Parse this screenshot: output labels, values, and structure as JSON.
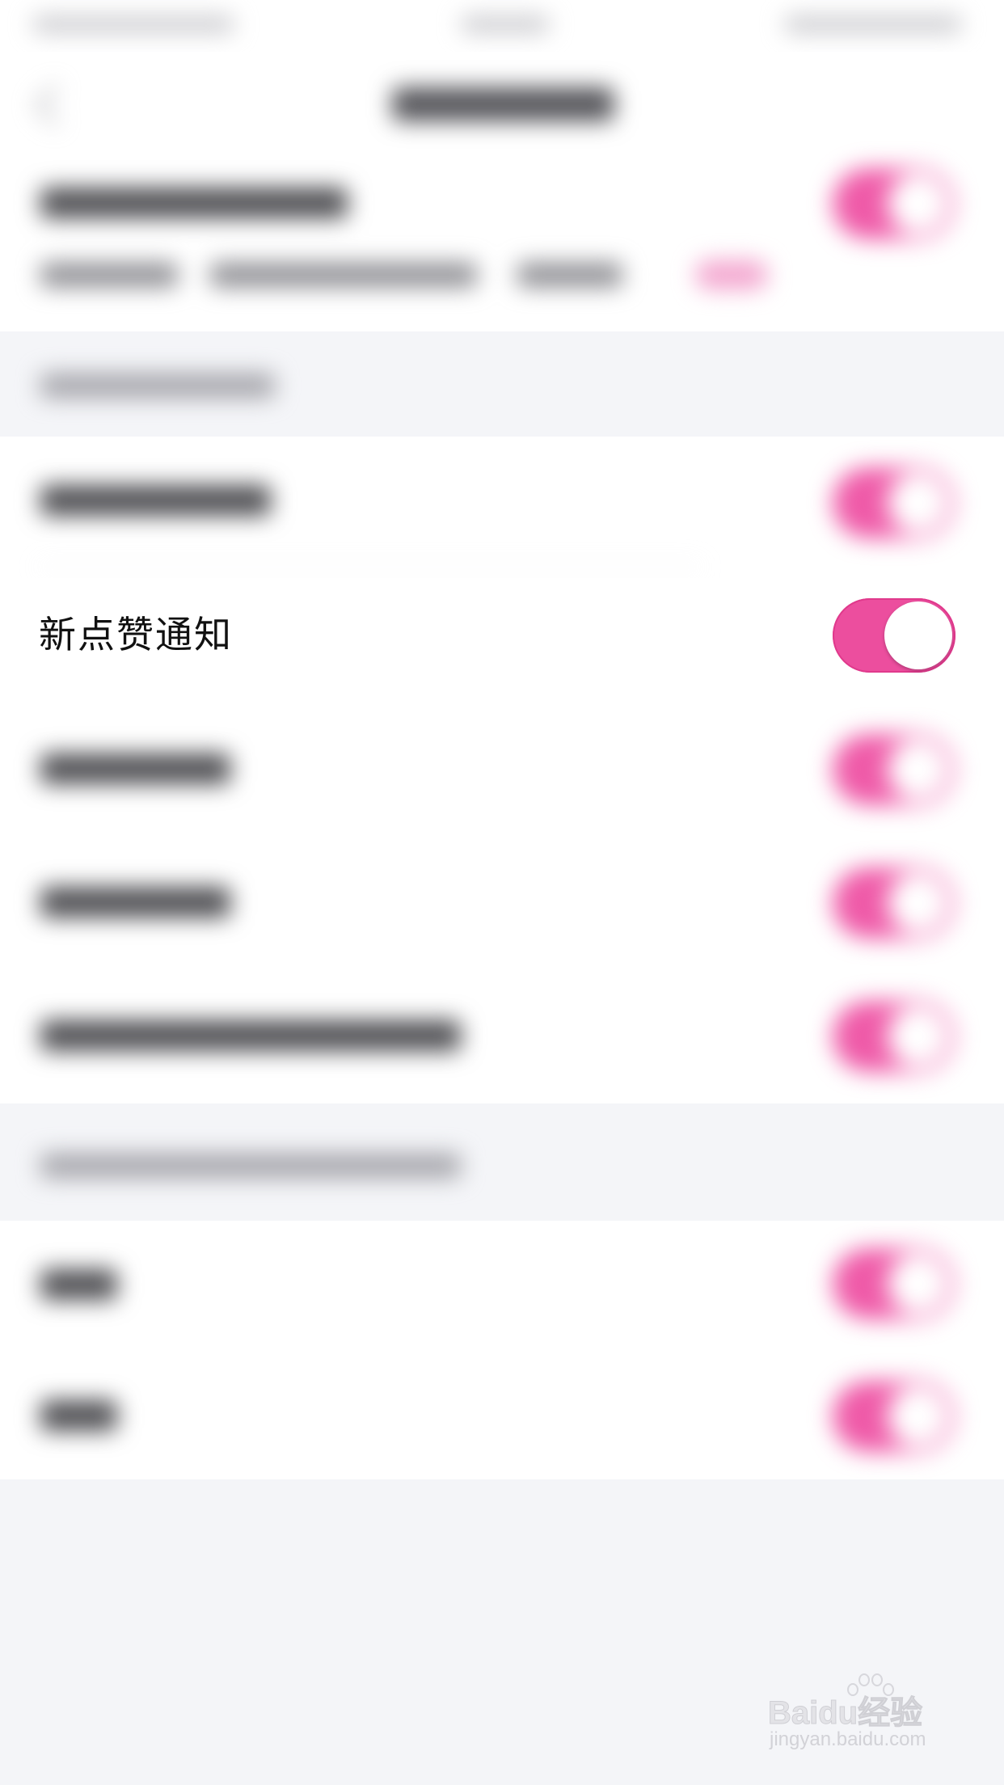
{
  "colors": {
    "accent": "#ec4e9e",
    "background": "#f4f5f8",
    "row_background": "#ffffff",
    "label_text": "#111111"
  },
  "focused_setting": {
    "label": "新点赞通知",
    "toggle_on": true
  },
  "watermark": {
    "brand": "Baidu经验",
    "url": "jingyan.baidu.com"
  }
}
